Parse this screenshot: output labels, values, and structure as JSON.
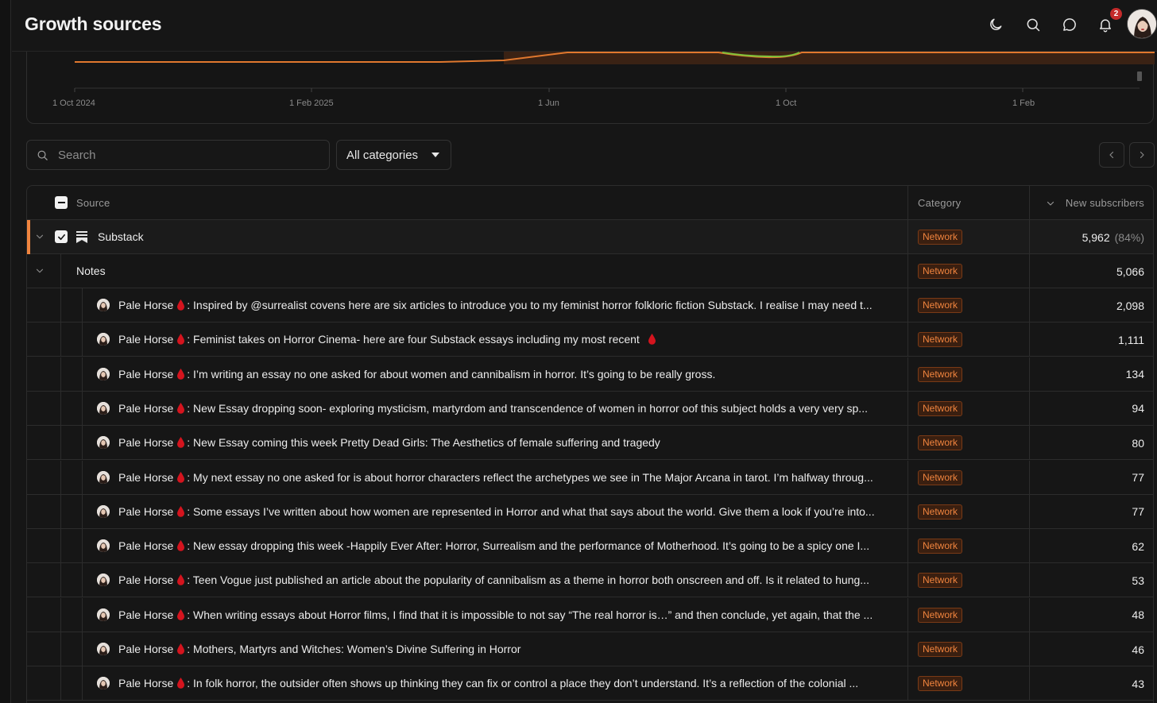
{
  "header": {
    "title": "Growth sources",
    "notification_count": "2"
  },
  "chart": {
    "x_ticks": [
      "1 Oct 2024",
      "1 Feb 2025",
      "1 Jun",
      "1 Oct",
      "1 Feb"
    ]
  },
  "controls": {
    "search_placeholder": "Search",
    "category_selected": "All categories"
  },
  "table": {
    "columns": {
      "source": "Source",
      "category": "Category",
      "new_subscribers": "New subscribers"
    },
    "group": {
      "name": "Substack",
      "category": "Network",
      "count": "5,962",
      "percent": "(84%)"
    },
    "subgroup": {
      "name": "Notes",
      "category": "Network",
      "count": "5,066"
    },
    "rows": [
      {
        "author": "Pale Horse",
        "text": ": Inspired by @surrealist covens here are six articles to introduce you to my feminist horror folkloric fiction Substack. I realise I may need t...",
        "category": "Network",
        "count": "2,098",
        "trailing_drop": false
      },
      {
        "author": "Pale Horse",
        "text": ": Feminist takes on Horror Cinema- here are four Substack essays including my most recent",
        "category": "Network",
        "count": "1,111",
        "trailing_drop": true
      },
      {
        "author": "Pale Horse",
        "text": ": I’m writing an essay no one asked for about women and cannibalism in horror. It’s going to be really gross.",
        "category": "Network",
        "count": "134",
        "trailing_drop": false
      },
      {
        "author": "Pale Horse",
        "text": ": New Essay dropping soon- exploring mysticism, martyrdom and transcendence of women in horror oof this subject holds a very very sp...",
        "category": "Network",
        "count": "94",
        "trailing_drop": false
      },
      {
        "author": "Pale Horse",
        "text": ": New Essay coming this week Pretty Dead Girls: The Aesthetics of female suffering and tragedy",
        "category": "Network",
        "count": "80",
        "trailing_drop": false
      },
      {
        "author": "Pale Horse",
        "text": ": My next essay no one asked for is about horror characters reflect the archetypes we see in The Major Arcana in tarot. I’m halfway throug...",
        "category": "Network",
        "count": "77",
        "trailing_drop": false
      },
      {
        "author": "Pale Horse",
        "text": ": Some essays I’ve written about how women are represented in Horror and what that says about the world. Give them a look if you’re into...",
        "category": "Network",
        "count": "77",
        "trailing_drop": false
      },
      {
        "author": "Pale Horse",
        "text": ": New essay dropping this week -Happily Ever After: Horror, Surrealism and the performance of Motherhood. It’s going to be a spicy one I...",
        "category": "Network",
        "count": "62",
        "trailing_drop": false
      },
      {
        "author": "Pale Horse",
        "text": ": Teen Vogue just published an article about the popularity of cannibalism as a theme in horror both onscreen and off. Is it related to hung...",
        "category": "Network",
        "count": "53",
        "trailing_drop": false
      },
      {
        "author": "Pale Horse",
        "text": ": When writing essays about Horror films, I find that it is impossible to not say “The real horror is…” and then conclude, yet again, that the ...",
        "category": "Network",
        "count": "48",
        "trailing_drop": false
      },
      {
        "author": "Pale Horse",
        "text": ": Mothers, Martyrs and Witches: Women’s Divine Suffering in Horror",
        "category": "Network",
        "count": "46",
        "trailing_drop": false
      },
      {
        "author": "Pale Horse",
        "text": ": In folk horror, the outsider often shows up thinking they can fix or control a place they don’t understand. It’s a reflection of the colonial ...",
        "category": "Network",
        "count": "43",
        "trailing_drop": false
      }
    ]
  },
  "colors": {
    "accent_orange": "#f0843e",
    "drop_red": "#d4141e",
    "background": "#161616"
  }
}
